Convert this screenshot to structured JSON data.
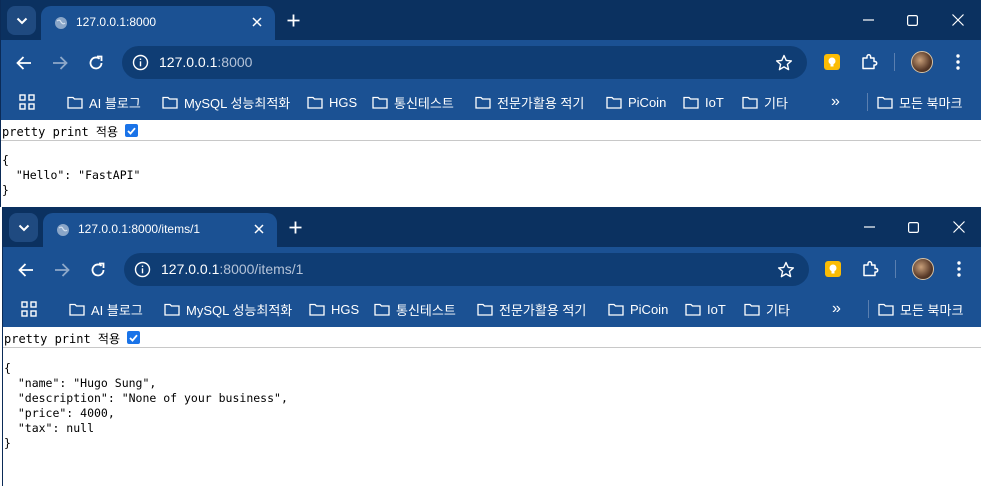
{
  "windows": [
    {
      "tab_title": "127.0.0.1:8000",
      "url_host": "127.0.0.1",
      "url_rest": ":8000",
      "pretty_print_label": "pretty print 적용",
      "json_lines": [
        "{",
        "  \"Hello\": \"FastAPI\"",
        "}"
      ]
    },
    {
      "tab_title": "127.0.0.1:8000/items/1",
      "url_host": "127.0.0.1",
      "url_rest": ":8000/items/1",
      "pretty_print_label": "pretty print 적용",
      "json_lines": [
        "{",
        "  \"name\": \"Hugo Sung\",",
        "  \"description\": \"None of your business\",",
        "  \"price\": 4000,",
        "  \"tax\": null",
        "}"
      ]
    }
  ],
  "bookmarks": [
    "AI 블로그",
    "MySQL 성능최적화",
    "HGS",
    "통신테스트",
    "전문가활용 적기",
    "PiCoin",
    "IoT",
    "기타"
  ],
  "all_bookmarks_label": "모든 북마크",
  "overflow_label": "»",
  "icons": {
    "tab_search": "chevron-down-icon",
    "tab_favicon": "globe-icon",
    "close": "close-icon",
    "new_tab": "plus-icon",
    "back": "arrow-left-icon",
    "forward": "arrow-right-icon",
    "reload": "reload-icon",
    "site_info": "info-icon",
    "bookmark_star": "star-icon",
    "apps": "apps-grid-icon",
    "folder": "folder-icon",
    "extensions": "puzzle-icon"
  },
  "colors": {
    "titlebar": "#0b3160",
    "toolbar": "#1b5193",
    "omnibox": "#0f3d74",
    "checkbox": "#1a73e8",
    "keep_extension": "#fbbc04"
  },
  "pretty_print_checked": true
}
